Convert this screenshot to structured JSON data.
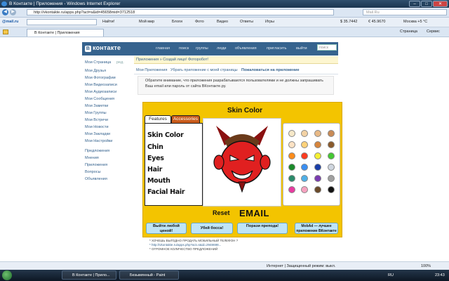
{
  "window": {
    "title": "В Контакте | Приложения - Windows Internet Explorer",
    "buttons": [
      "–",
      "□",
      "✕"
    ]
  },
  "addressbar": {
    "url": "http://vkontakte.ru/apps.php?act=s&id=45658mid=3712518",
    "search_placeholder": "Mail.Ru"
  },
  "toolbar": {
    "brand": "@mail.ru",
    "find_label": "Найти!",
    "items": [
      "Мой мир",
      "Блоги",
      "Фото",
      "Видео",
      "Ответы",
      "Игры"
    ],
    "rates": [
      "$ 35.7442",
      "€ 45.9670"
    ],
    "weather": "Москва +5 °C"
  },
  "tabbar": {
    "tab_label": "В Контакте | Приложения",
    "tools": [
      "Страница",
      "Сервис"
    ]
  },
  "vk": {
    "logo": "контакте",
    "nav": [
      "главная",
      "поиск",
      "группы",
      "люди",
      "объявления",
      "пригласить",
      "выйти"
    ],
    "search_placeholder": "поиск",
    "sidebar": [
      "Мои Страница",
      "ред.",
      "Мои Друзья",
      "Мои Фотографии",
      "Мои Видеозаписи",
      "Мои Аудиозаписи",
      "Мои Сообщения",
      "Мои Заметки",
      "Мои Группы",
      "Мои Встречи",
      "Мои Новости",
      "Мои Закладки",
      "Мои Настройки",
      "Предложения",
      "Мнения",
      "Приложения",
      "Вопросы",
      "Объявления"
    ],
    "breadcrumb": "Приложения » Создай лицо! Фоторобот!",
    "subnav": [
      "Мои Приложения",
      "Убрать приложение с моей страницы",
      "Пожаловаться на приложение"
    ],
    "notice": "Обратите внимание, что приложения разрабатываются пользователями и не должны запрашивать Ваш email или пароль от сайта ВКонтакте.ру."
  },
  "app": {
    "title": "Skin Color",
    "tabs": [
      "Features",
      "Accessories"
    ],
    "features": [
      "Skin Color",
      "Chin",
      "Eyes",
      "Hair",
      "Mouth",
      "Facial Hair"
    ],
    "reset_label": "Reset",
    "email_label": "EMAIL",
    "buttons": [
      "Выйти любой ценой!",
      "Убей босса!",
      "Порази препода!",
      "MobAd — лучшее приложение ВКонтакте"
    ],
    "palette_colors": [
      "#f6e8c8",
      "#f3d2a4",
      "#e8b985",
      "#c98b56",
      "#fde2c4",
      "#ffd27a",
      "#d6853c",
      "#8a5a2b",
      "#ff8c1a",
      "#ff3b1f",
      "#f5f033",
      "#45c833",
      "#1a8a2a",
      "#3b8ff2",
      "#1a3fa8",
      "#cfd6df",
      "#2a8a6a",
      "#4fb0e8",
      "#7a3bb0",
      "#a0a0a0",
      "#e83aa0",
      "#f7a2c0",
      "#6a4a2a",
      "#111111"
    ]
  },
  "footer": {
    "lines": [
      "* ХОЧЕШЬ ВЫГОДНО ПРОДАТЬ МОБИЛЬНЫЙ ТЕЛЕФОН ?",
      "* http://vkontakte.ru/apps.php?act=s&id=2948698...",
      "* ОГРОМНОЕ КОЛИЧЕСТВО ПРЕДЛОЖЕНИЙ"
    ]
  },
  "statusbar": {
    "zone": "Интернет | Защищенный режим: выкл.",
    "zoom": "100%"
  },
  "taskbar": {
    "tasks": [
      "В Контакте | Прило...",
      "Безымянный - Paint"
    ],
    "lang": "RU",
    "time": "23:43"
  }
}
